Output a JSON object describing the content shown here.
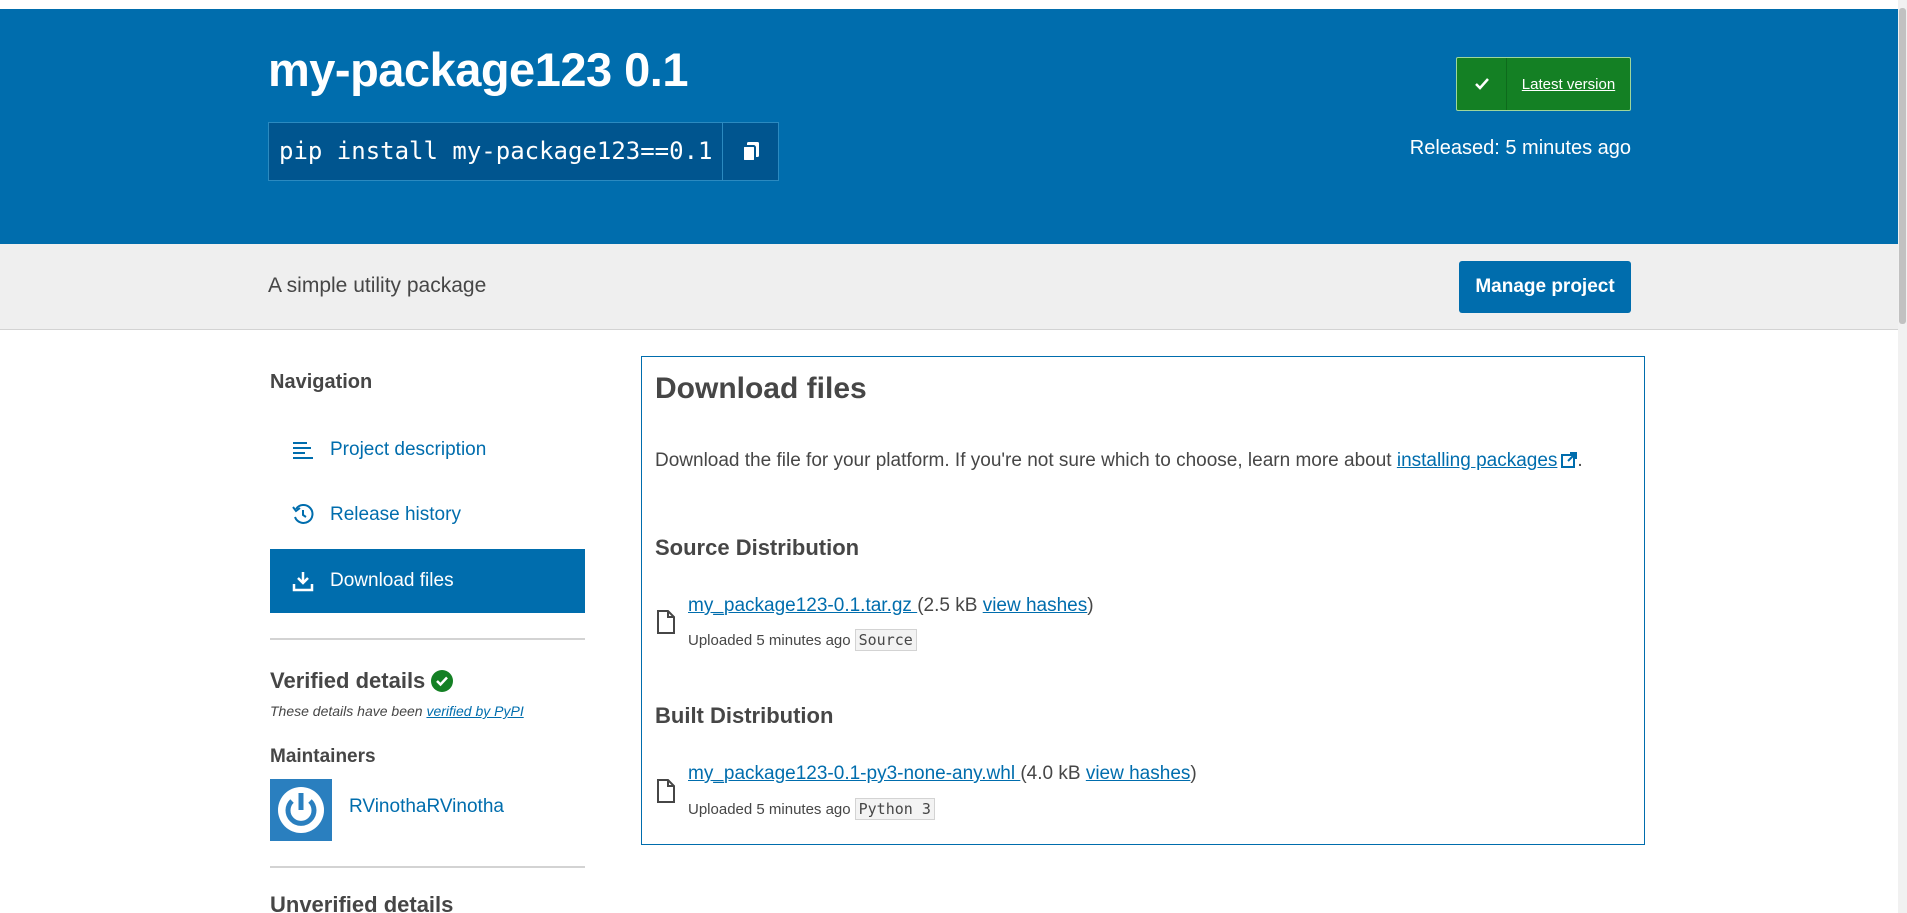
{
  "header": {
    "title": "my-package123 0.1",
    "pip_command": "pip install my-package123==0.1",
    "latest_badge": "Latest version",
    "released": "Released: 5 minutes ago"
  },
  "subbar": {
    "summary": "A simple utility package",
    "manage_button": "Manage project"
  },
  "sidebar": {
    "heading": "Navigation",
    "items": [
      {
        "label": "Project description",
        "icon": "align-left-icon",
        "active": false
      },
      {
        "label": "Release history",
        "icon": "history-icon",
        "active": false
      },
      {
        "label": "Download files",
        "icon": "download-icon",
        "active": true
      }
    ],
    "verified_heading": "Verified details",
    "verified_note_prefix": "These details have been ",
    "verified_note_link": "verified by PyPI",
    "maintainers_heading": "Maintainers",
    "maintainer_name": "RVinothaRVinotha",
    "unverified_heading": "Unverified details"
  },
  "main": {
    "heading": "Download files",
    "description": "Download the file for your platform. If you're not sure which to choose, learn more about ",
    "description_link": "installing packages",
    "description_end": ".",
    "sections": [
      {
        "heading": "Source Distribution",
        "file_name": "my_package123-0.1.tar.gz ",
        "size": "(2.5 kB ",
        "hashes_link": "view hashes",
        "size_close": ")",
        "uploaded": "Uploaded 5 minutes ago",
        "tag": "Source"
      },
      {
        "heading": "Built Distribution",
        "file_name": "my_package123-0.1-py3-none-any.whl ",
        "size": "(4.0 kB ",
        "hashes_link": "view hashes",
        "size_close": ")",
        "uploaded": "Uploaded 5 minutes ago",
        "tag": "Python 3"
      }
    ]
  },
  "colors": {
    "brand_blue": "#006dad",
    "badge_green": "#148024",
    "verified_green": "#148024",
    "subbar_gray": "#efefef"
  }
}
